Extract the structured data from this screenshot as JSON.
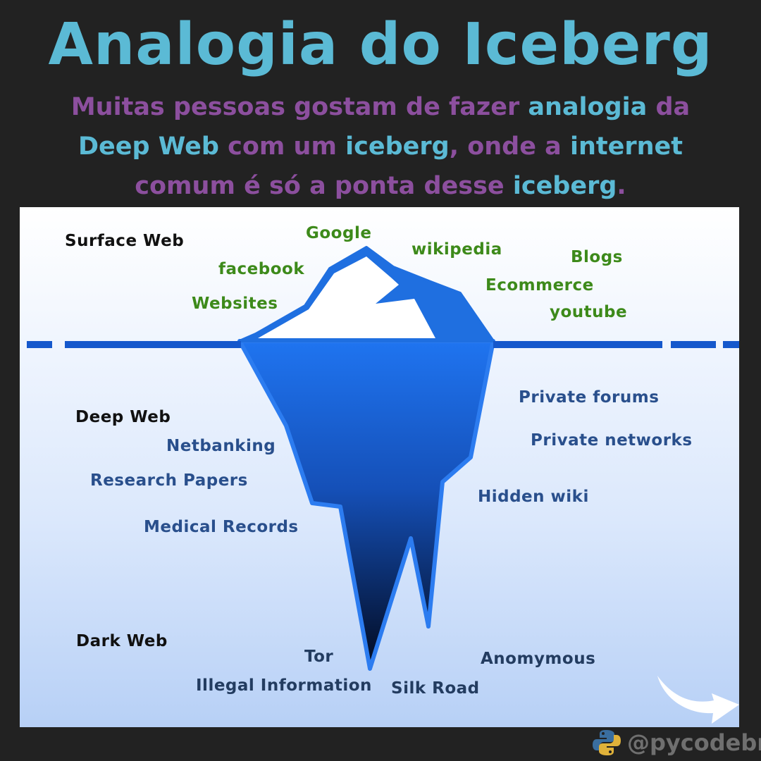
{
  "title": "Analogia do Iceberg",
  "subtitle": {
    "parts": [
      {
        "text": "Muitas pessoas gostam de fazer ",
        "color": "#8c4f9e"
      },
      {
        "text": "analogia ",
        "color": "#5bbad5"
      },
      {
        "text": "da",
        "color": "#8c4f9e"
      },
      {
        "text": " Deep Web",
        "color": "#5bbad5"
      },
      {
        "text": " com um ",
        "color": "#8c4f9e"
      },
      {
        "text": "iceberg",
        "color": "#5bbad5"
      },
      {
        "text": ", onde a ",
        "color": "#8c4f9e"
      },
      {
        "text": "internet",
        "color": "#5bbad5"
      },
      {
        "text": " comum é só a ponta desse ",
        "color": "#8c4f9e"
      },
      {
        "text": "iceberg",
        "color": "#5bbad5"
      },
      {
        "text": ".",
        "color": "#8c4f9e"
      }
    ]
  },
  "diagram": {
    "surface": {
      "title": "Surface Web",
      "items": [
        "Google",
        "wikipedia",
        "facebook",
        "Blogs",
        "Ecommerce",
        "Websites",
        "youtube"
      ]
    },
    "deep": {
      "title": "Deep Web",
      "items": [
        "Private forums",
        "Netbanking",
        "Private networks",
        "Research Papers",
        "Hidden wiki",
        "Medical Records"
      ]
    },
    "dark": {
      "title": "Dark Web",
      "items": [
        "Tor",
        "Anomymous",
        "Illegal Information",
        "Silk Road"
      ]
    }
  },
  "handle": "@pycodebr",
  "colors": {
    "title": "#5bbad5",
    "accent_purple": "#8c4f9e",
    "surface_items": "#3d8a1a",
    "deep_items": "#294f8c",
    "iceberg": "#1d6fe6",
    "waterline": "#1558cc",
    "background": "#222222"
  },
  "icons": {
    "arrow": "next-arrow-icon",
    "logo": "python-logo-icon"
  }
}
